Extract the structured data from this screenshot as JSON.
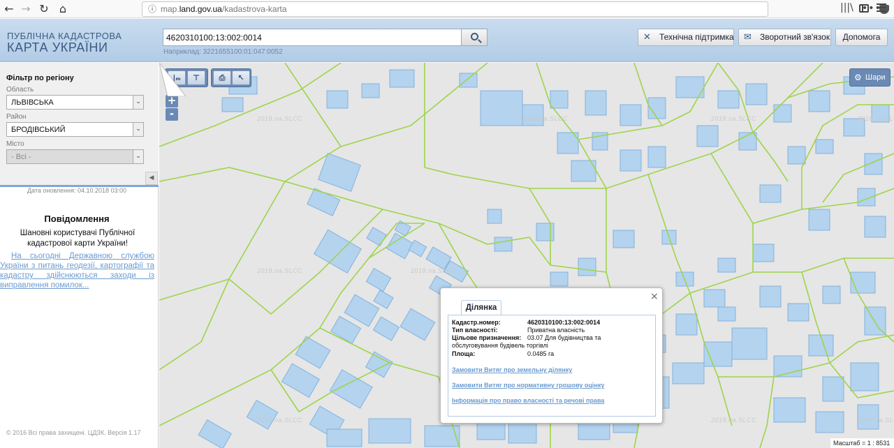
{
  "browser": {
    "back_icon": "back-arrow-icon",
    "forward_icon": "forward-arrow-icon",
    "reload_icon": "reload-icon",
    "home_icon": "home-icon",
    "url_domain": "map.land.gov.ua",
    "url_path": "/kadastrova-karta",
    "url_prefix": "map.",
    "url_host": "land.gov.ua",
    "more_dots": "•••",
    "colors": {
      "star": "#0a84ff"
    }
  },
  "header": {
    "logo_line1": "ПУБЛІЧНА КАДАСТРОВА",
    "logo_line2": "КАРТА УКРАЇНИ",
    "search_value": "4620310100:13:002:0014",
    "search_hint": "Наприклад: 3221655100:01:047:0052",
    "buttons": {
      "support": "Технічна підтримка",
      "feedback": "Зворотний зв'язок",
      "help": "Допомога"
    },
    "colors": {
      "gradient_top": "#c9dcef",
      "gradient_bottom": "#b2cce6",
      "logo": "#3a5b86"
    }
  },
  "sidebar": {
    "filter_title": "Фільтр по регіону",
    "oblast_label": "Область",
    "oblast_value": "ЛЬВІВСЬКА",
    "rayon_label": "Район",
    "rayon_value": "БРОДІВСЬКИЙ",
    "city_label": "Місто",
    "city_value": "- Всі -",
    "update_date": "Дата оновлення: 04.10.2018 03:00",
    "notice_title": "Повідомлення",
    "notice_body": "Шановні користувачі Публічної кадастрової карти України!",
    "notice_link": "На сьогодні Державною службою України з питань геодезії, картографії та кадастру здійснюються заходи із виправлення помилок...",
    "copyright": "© 2016 Всі права захищені. ЦДЗК. Версія 1.17"
  },
  "map": {
    "layers_label": "Шари",
    "zoom_in": "+",
    "zoom_out": "-",
    "scale_text": "Масштаб = 1 : 8531",
    "watermark": "2018.na.SLCC",
    "colors": {
      "background": "#e6e6e6",
      "parcel_line": "#9ed44a",
      "building_fill": "#b3d3ef",
      "building_stroke": "#86b2da"
    }
  },
  "popup": {
    "tab_label": "Ділянка",
    "fields": {
      "cadastral_number_label": "Кадастр.номер:",
      "cadastral_number_value": "4620310100:13:002:0014",
      "ownership_label": "Тип власності:",
      "ownership_value": "Приватна власність",
      "purpose_label": "Цільове призначення:",
      "purpose_value": "03.07 Для будівництва та обслуговування будівель торгівлі",
      "area_label": "Площа:",
      "area_value": "0.0485 га"
    },
    "links": {
      "extract_land": "Замовити Витяг про земельну ділянку",
      "extract_valuation": "Замовити Витяг про нормативну грошову оцінку",
      "ownership_info": "Інформація про право власності та речові права"
    }
  }
}
